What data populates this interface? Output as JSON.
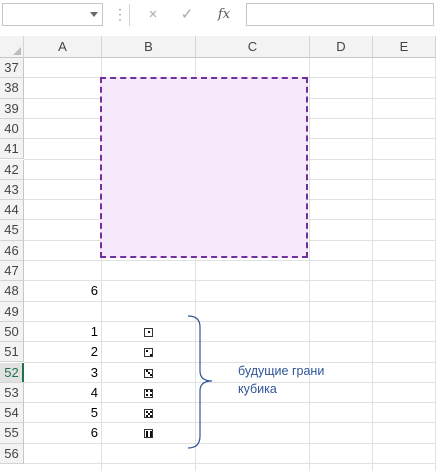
{
  "formula_bar": {
    "name_box_value": "",
    "formula_value": "",
    "cancel_glyph": "×",
    "enter_glyph": "✓",
    "fx_label": "fx",
    "dots_glyph": "⋮"
  },
  "sheet": {
    "columns": [
      "A",
      "B",
      "C",
      "D",
      "E"
    ],
    "rows": [
      "37",
      "38",
      "39",
      "40",
      "41",
      "42",
      "43",
      "44",
      "45",
      "46",
      "47",
      "48",
      "49",
      "50",
      "51",
      "52",
      "53",
      "54",
      "55",
      "56"
    ],
    "active_row": "52",
    "cells": {
      "A48": "6",
      "A50": "1",
      "A51": "2",
      "A52": "3",
      "A53": "4",
      "A54": "5",
      "A55": "6"
    },
    "dice": [
      1,
      2,
      3,
      4,
      5,
      6
    ],
    "shape_fill": "#f6e9fc",
    "shape_border": "#7030a0",
    "brace_color": "#2f5597",
    "annotation": {
      "line1": "будущие грани",
      "line2": "кубика"
    }
  }
}
